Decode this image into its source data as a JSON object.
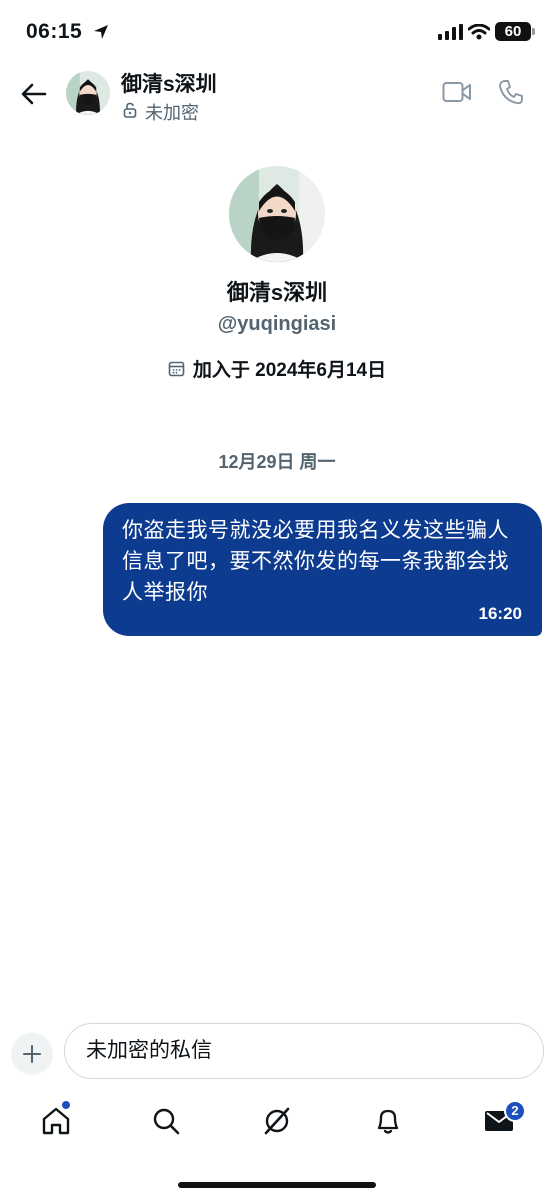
{
  "status_bar": {
    "time": "06:15",
    "battery": "60"
  },
  "header": {
    "name": "御清s深圳",
    "encryption": "未加密"
  },
  "profile": {
    "name": "御清s深圳",
    "handle": "@yuqingiasi",
    "joined": "加入于 2024年6月14日"
  },
  "conversation": {
    "date_separator": "12月29日 周一",
    "messages": [
      {
        "text": "你盗走我号就没必要用我名义发这些骗人信息了吧，要不然你发的每一条我都会找人举报你",
        "time": "16:20",
        "sent": true
      }
    ]
  },
  "composer": {
    "placeholder": "未加密的私信"
  },
  "nav": {
    "messages_badge": "2"
  },
  "colors": {
    "accent": "#1d4fbf",
    "bubble": "#0c3b8f",
    "muted": "#536471"
  }
}
